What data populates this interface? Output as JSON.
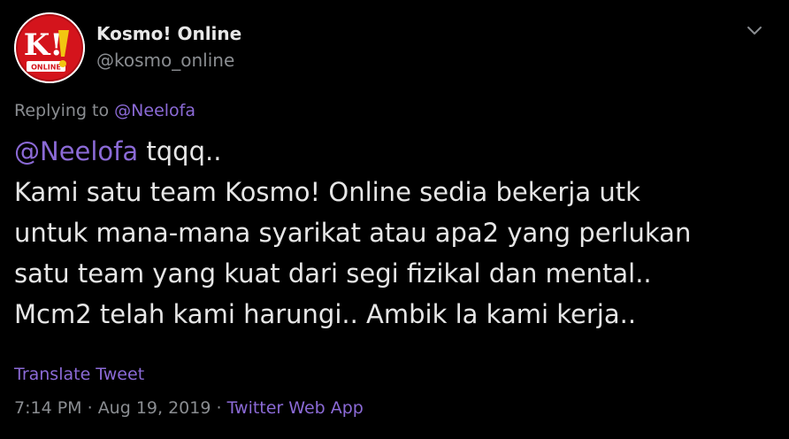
{
  "author": {
    "display_name": "Kosmo! Online",
    "handle": "@kosmo_online",
    "avatar_label": "K!",
    "avatar_sublabel": "ONLINE",
    "brand_color": "#d4141c"
  },
  "reply": {
    "prefix": "Replying to",
    "mention": "@Neelofa"
  },
  "tweet": {
    "mention": "@Neelofa",
    "line1_rest": " tqqq..",
    "lines": [
      "Kami satu team Kosmo! Online sedia bekerja utk",
      "untuk mana-mana syarikat atau apa2 yang perlukan",
      "satu team yang kuat dari segi fizikal dan mental..",
      "Mcm2 telah kami harungi.. Ambik la kami kerja.."
    ]
  },
  "translate_label": "Translate Tweet",
  "meta": {
    "time": "7:14 PM",
    "separator": " · ",
    "date": "Aug 19, 2019",
    "source": "Twitter Web App"
  },
  "icons": {
    "menu": "chevron-down-icon"
  },
  "colors": {
    "background": "#000000",
    "link": "#8b6ad6",
    "muted": "#8a8d91",
    "text": "#e6e6e6"
  }
}
